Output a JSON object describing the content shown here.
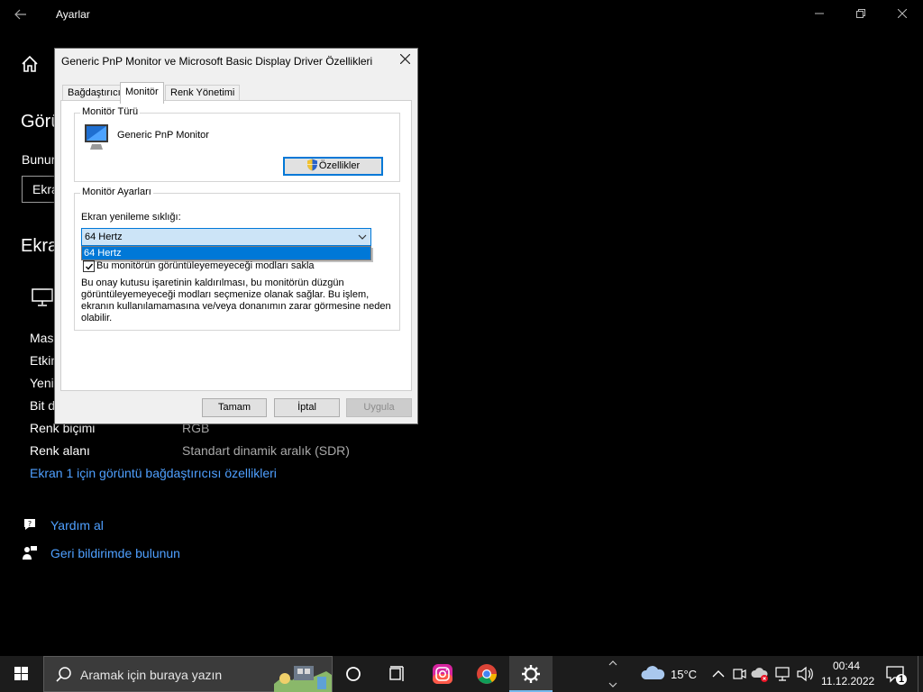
{
  "settings": {
    "app_title": "Ayarlar",
    "page_heading": "Görü",
    "sub_label": "Bunur",
    "combo_value": "Ekra",
    "section_heading": "Ekra",
    "info_rows": [
      {
        "label": "Mas",
        "value": ""
      },
      {
        "label": "Etkin",
        "value": ""
      },
      {
        "label": "Yeni",
        "value": ""
      },
      {
        "label": "Bit d",
        "value": ""
      },
      {
        "label": "Renk biçimi",
        "value": "RGB"
      },
      {
        "label": "Renk alanı",
        "value": "Standart dinamik aralık (SDR)"
      }
    ],
    "adapter_link": "Ekran 1 için görüntü bağdaştırıcısı özellikleri",
    "help_link": "Yardım al",
    "feedback_link": "Geri bildirimde bulunun"
  },
  "dialog": {
    "title": "Generic PnP Monitor ve Microsoft Basic Display Driver Özellikleri",
    "tabs": [
      {
        "label": "Bağdaştırıcı",
        "active": false
      },
      {
        "label": "Monitör",
        "active": true
      },
      {
        "label": "Renk Yönetimi",
        "active": false
      }
    ],
    "monitor_type": {
      "group_label": "Monitör Türü",
      "monitor_name": "Generic PnP Monitor",
      "properties_button": "Özellikler"
    },
    "monitor_settings": {
      "group_label": "Monitör Ayarları",
      "refresh_label": "Ekran yenileme sıklığı:",
      "refresh_value": "64 Hertz",
      "dropdown_options": [
        "64 Hertz"
      ],
      "hide_modes_label": "Bu monitörün görüntüleyemeyeceği modları sakla",
      "hide_modes_checked": true,
      "warning_text": "Bu onay kutusu işaretinin kaldırılması, bu monitörün düzgün görüntüleyemeyeceği modları seçmenize olanak sağlar. Bu işlem, ekranın kullanılamamasına ve/veya donanımın zarar görmesine neden olabilir."
    },
    "buttons": {
      "ok": "Tamam",
      "cancel": "İptal",
      "apply": "Uygula"
    }
  },
  "taskbar": {
    "search_placeholder": "Aramak için buraya yazın",
    "weather": "15°C",
    "time": "00:44",
    "date": "11.12.2022",
    "notification_count": "1"
  },
  "colors": {
    "accent": "#0078d7",
    "link": "#4fa0ff"
  }
}
